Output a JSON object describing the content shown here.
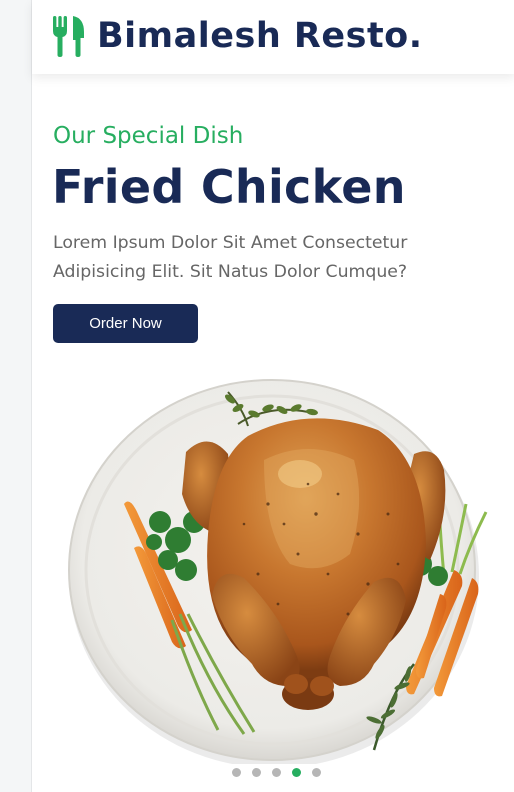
{
  "brand": {
    "name": "Bimalesh Resto.",
    "icon": "utensils-icon",
    "icon_color": "#27ae60"
  },
  "hero": {
    "subtitle": "Our Special Dish",
    "title": "Fried Chicken",
    "description": "Lorem Ipsum Dolor Sit Amet Consectetur Adipisicing Elit. Sit Natus Dolor Cumque?",
    "button_label": "Order Now",
    "image": "roast-chicken-plate-image"
  },
  "slider": {
    "total": 5,
    "active_index": 4
  },
  "colors": {
    "accent": "#27ae60",
    "primary": "#192a56",
    "text": "#666666"
  }
}
